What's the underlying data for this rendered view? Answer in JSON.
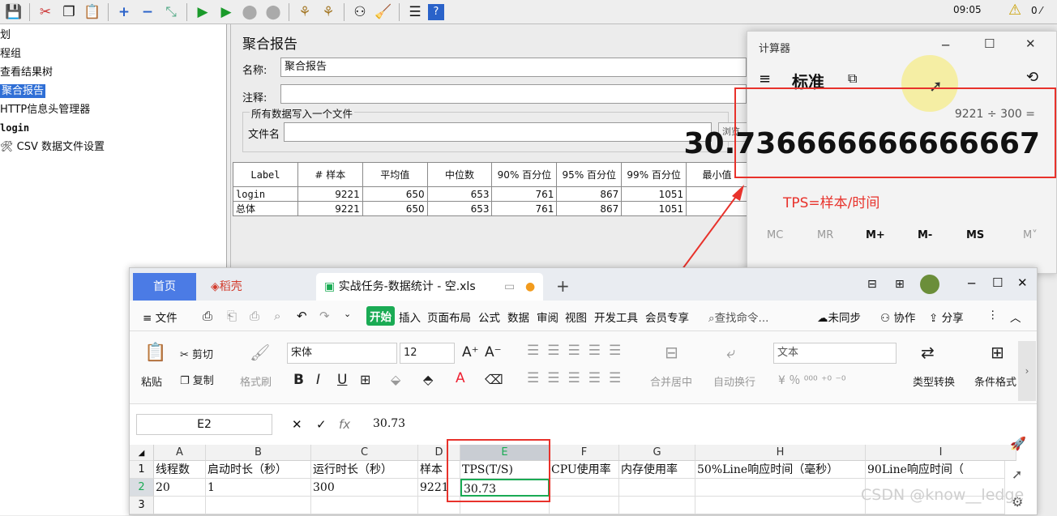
{
  "jmeter": {
    "toolbar_icons": [
      "save-icon",
      "cut-icon",
      "copy-icon",
      "paste-icon",
      "expand-icon",
      "collapse-icon",
      "toggle-icon",
      "start-icon",
      "start-no-pause-icon",
      "stop-icon",
      "shutdown-icon",
      "clear-icon",
      "clear-all-icon",
      "search-icon",
      "reset-search-icon",
      "function-helper-icon",
      "help-icon"
    ],
    "clock": "09:05",
    "tree": [
      "划",
      "程组",
      "查看结果树",
      "聚合报告",
      "HTTP信息头管理器",
      "login",
      "CSV 数据文件设置"
    ],
    "title": "聚合报告",
    "name_label": "名称:",
    "name_value": "聚合报告",
    "comment_label": "注释:",
    "file_group_label": "所有数据写入一个文件",
    "file_name_label": "文件名",
    "browse_label": "浏览",
    "table": {
      "headers": [
        "Label",
        "# 样本",
        "平均值",
        "中位数",
        "90% 百分位",
        "95% 百分位",
        "99% 百分位",
        "最小值"
      ],
      "rows": [
        [
          "login",
          "9221",
          "650",
          "653",
          "761",
          "867",
          "1051",
          ""
        ],
        [
          "总体",
          "9221",
          "650",
          "653",
          "761",
          "867",
          "1051",
          ""
        ]
      ]
    }
  },
  "calculator": {
    "title": "计算器",
    "mode": "标准",
    "expression": "9221 ÷ 300 =",
    "result": "30.736666666666667",
    "memory": [
      "MC",
      "MR",
      "M+",
      "M-",
      "MS",
      "M˅"
    ]
  },
  "annotation": {
    "tps_note": "TPS=样本/时间"
  },
  "wps": {
    "tabs": {
      "home": "首页",
      "daoke": "稻壳",
      "doc": "实战任务-数据统计 - 空.xls"
    },
    "menu": {
      "file": "文件",
      "items": [
        "开始",
        "插入",
        "页面布局",
        "公式",
        "数据",
        "审阅",
        "视图",
        "开发工具",
        "会员专享"
      ],
      "search": "查找命令...",
      "sync": "未同步",
      "collab": "协作",
      "share": "分享"
    },
    "ribbon": {
      "paste": "粘贴",
      "cut": "剪切",
      "copy": "复制",
      "format_painter": "格式刷",
      "font": "宋体",
      "size": "12",
      "merge": "合并居中",
      "wrap": "自动换行",
      "number_format": "文本",
      "convert": "类型转换",
      "cond_format": "条件格式"
    },
    "cell_ref": "E2",
    "formula": "30.73",
    "columns": [
      "A",
      "B",
      "C",
      "D",
      "E",
      "F",
      "G",
      "H",
      "I"
    ],
    "rows": [
      {
        "num": "1",
        "cells": [
          "线程数",
          "启动时长（秒）",
          "运行时长（秒）",
          "样本",
          "TPS(T/S)",
          "CPU使用率",
          "内存使用率",
          "50%Line响应时间（毫秒）",
          "90Line响应时间（"
        ]
      },
      {
        "num": "2",
        "cells": [
          "20",
          "1",
          "300",
          "9221",
          "30.73",
          "",
          "",
          "",
          ""
        ]
      },
      {
        "num": "3",
        "cells": [
          "",
          "",
          "",
          "",
          "",
          "",
          "",
          "",
          ""
        ]
      }
    ],
    "watermark": "CSDN @know__ledge"
  },
  "colors": {
    "accent_red": "#e8322b",
    "selection_blue": "#2f6fd6",
    "wps_green": "#1aab54"
  }
}
